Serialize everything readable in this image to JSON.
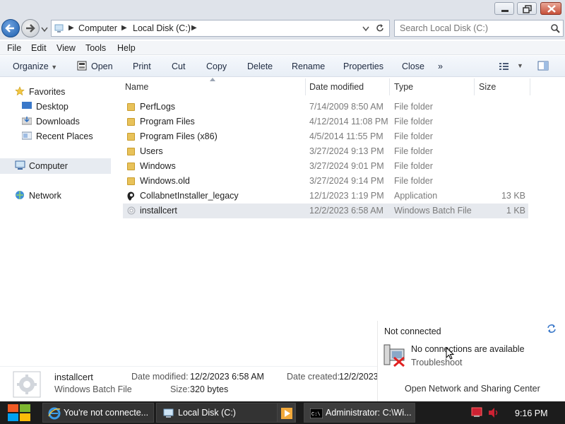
{
  "address": {
    "breadcrumbs": [
      "Computer",
      "Local Disk (C:)"
    ]
  },
  "search": {
    "placeholder": "Search Local Disk (C:)"
  },
  "menubar": {
    "items": [
      "File",
      "Edit",
      "View",
      "Tools",
      "Help"
    ]
  },
  "toolbar": {
    "organize": "Organize",
    "open": "Open",
    "print": "Print",
    "cut": "Cut",
    "copy": "Copy",
    "delete": "Delete",
    "rename": "Rename",
    "properties": "Properties",
    "close": "Close",
    "more": "»"
  },
  "navpane": {
    "favorites": "Favorites",
    "desktop": "Desktop",
    "downloads": "Downloads",
    "recent": "Recent Places",
    "computer": "Computer",
    "network": "Network"
  },
  "columns": {
    "name": "Name",
    "date": "Date modified",
    "type": "Type",
    "size": "Size"
  },
  "files": [
    {
      "name": "PerfLogs",
      "date": "7/14/2009 8:50 AM",
      "type": "File folder",
      "size": "",
      "icon": "folder-icon"
    },
    {
      "name": "Program Files",
      "date": "4/12/2014 11:08 PM",
      "type": "File folder",
      "size": "",
      "icon": "folder-icon"
    },
    {
      "name": "Program Files (x86)",
      "date": "4/5/2014 11:55 PM",
      "type": "File folder",
      "size": "",
      "icon": "folder-icon"
    },
    {
      "name": "Users",
      "date": "3/27/2024 9:13 PM",
      "type": "File folder",
      "size": "",
      "icon": "folder-icon"
    },
    {
      "name": "Windows",
      "date": "3/27/2024 9:01 PM",
      "type": "File folder",
      "size": "",
      "icon": "folder-icon"
    },
    {
      "name": "Windows.old",
      "date": "3/27/2024 9:14 PM",
      "type": "File folder",
      "size": "",
      "icon": "folder-icon"
    },
    {
      "name": "CollabnetInstaller_legacy",
      "date": "12/1/2023 1:19 PM",
      "type": "Application",
      "size": "13 KB",
      "icon": "application-icon"
    },
    {
      "name": "installcert",
      "date": "12/2/2023 6:58 AM",
      "type": "Windows Batch File",
      "size": "1 KB",
      "icon": "batch-file-icon"
    }
  ],
  "details": {
    "name": "installcert",
    "type": "Windows Batch File",
    "modified_label": "Date modified:",
    "modified_value": "12/2/2023 6:58 AM",
    "size_label": "Size:",
    "size_value": "320 bytes",
    "created_label": "Date created:",
    "created_value": "12/2/2023"
  },
  "network_popup": {
    "status": "Not connected",
    "message": "No connections are available",
    "troubleshoot": "Troubleshoot",
    "link": "Open Network and Sharing Center"
  },
  "taskbar": {
    "tasks": [
      "You're not connecte...",
      "Local Disk (C:)",
      "Administrator: C:\\Wi..."
    ],
    "time": "9:16 PM"
  },
  "colors": {
    "accent": "#1d5fae",
    "close_button": "#c7513a",
    "taskbar": "#1c1c1c"
  }
}
